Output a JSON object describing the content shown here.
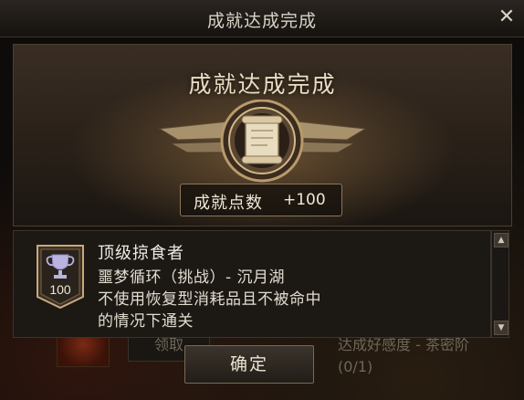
{
  "dialog": {
    "title": "成就达成完成",
    "close_icon": "close-icon"
  },
  "banner": {
    "title": "成就达成完成",
    "emblem_icon": "scroll-emblem-icon",
    "points_label": "成就点数",
    "points_value": "+100"
  },
  "achievement": {
    "name": "顶级掠食者",
    "badge_icon": "trophy-icon",
    "badge_value": "100",
    "lines": [
      "噩梦循环（挑战）- 沉月湖",
      "不使用恢复型消耗品且不被命中",
      "的情况下通关"
    ]
  },
  "scrollbar": {
    "up_icon": "scroll-up-icon",
    "down_icon": "scroll-down-icon"
  },
  "actions": {
    "confirm_label": "确定"
  },
  "background": {
    "receive_button": "领取",
    "desc_line": "达成好感度 - 茶密阶",
    "progress": "(0/1)"
  },
  "colors": {
    "accent_gold": "#c9a97a",
    "panel_bg": "#1c1814",
    "text_light": "#efe6d4"
  }
}
